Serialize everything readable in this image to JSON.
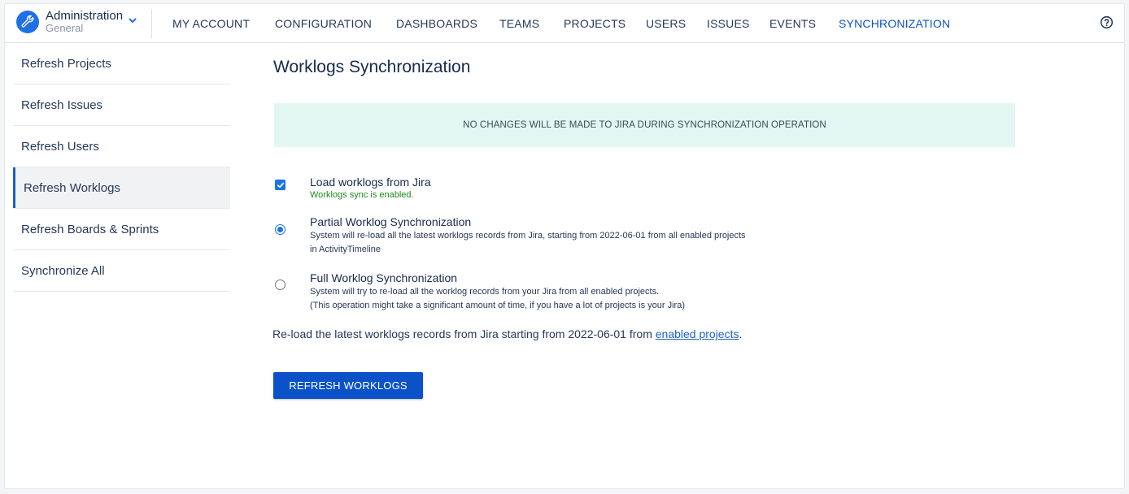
{
  "brand": {
    "title": "Administration",
    "subtitle": "General",
    "icon": "wrench-icon",
    "accent": "#1f6fe5"
  },
  "nav": {
    "items": [
      {
        "label": "MY ACCOUNT"
      },
      {
        "label": "CONFIGURATION"
      },
      {
        "label": "DASHBOARDS"
      },
      {
        "label": "TEAMS"
      },
      {
        "label": "PROJECTS"
      },
      {
        "label": "USERS"
      },
      {
        "label": "ISSUES"
      },
      {
        "label": "EVENTS"
      },
      {
        "label": "SYNCHRONIZATION",
        "active": true
      }
    ],
    "active_color": "#0b52c9",
    "help_icon": "help-circle-icon"
  },
  "sidebar": {
    "items": [
      {
        "label": "Refresh Projects"
      },
      {
        "label": "Refresh Issues"
      },
      {
        "label": "Refresh Users"
      },
      {
        "label": "Refresh Worklogs",
        "active": true
      },
      {
        "label": "Refresh Boards & Sprints"
      },
      {
        "label": "Synchronize All"
      }
    ]
  },
  "main": {
    "title": "Worklogs Synchronization",
    "banner": "NO CHANGES WILL BE MADE TO JIRA DURING SYNCHRONIZATION OPERATION",
    "banner_color": "#e2f6f2",
    "options": {
      "load": {
        "label": "Load worklogs from Jira",
        "status": "Worklogs sync is enabled.",
        "checked": true
      },
      "partial": {
        "label": "Partial Worklog Synchronization",
        "desc": "System will re-load all the latest worklogs records from Jira, starting from 2022-06-01 from all enabled projects in ActivityTimeline",
        "selected": true
      },
      "full": {
        "label": "Full Worklog Synchronization",
        "desc1": "System will try to re-load all the worklog records from your Jira from all enabled projects.",
        "desc2": "(This operation might take a significant amount of time, if you have a lot of projects is your Jira)",
        "selected": false
      }
    },
    "reload_text": "Re-load the latest worklogs records from Jira starting from 2022-06-01 from ",
    "reload_link": "enabled projects",
    "reload_end": ".",
    "button": "REFRESH WORKLOGS"
  }
}
